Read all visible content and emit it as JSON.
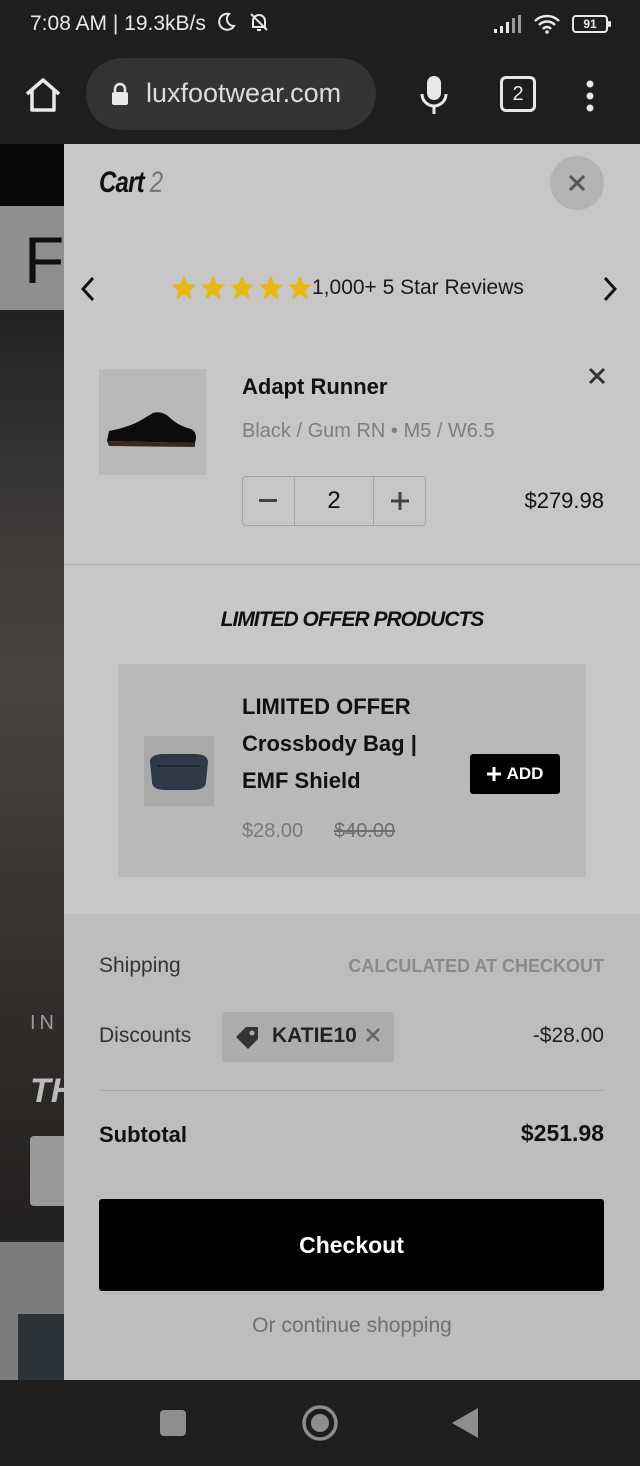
{
  "status_bar": {
    "time_and_speed": "7:08 AM | 19.3kB/s",
    "battery": "91"
  },
  "browser": {
    "url": "luxfootwear.com",
    "tab_count": "2"
  },
  "background_page": {
    "letter": "F",
    "text_in": "IN",
    "text_th": "TH"
  },
  "cart": {
    "title": "Cart",
    "count": "2",
    "reviews_text": "1,000+ 5 Star Reviews",
    "star_rating": 5,
    "line_item": {
      "name": "Adapt Runner",
      "variant": "Black / Gum RN • M5 / W6.5",
      "quantity": "2",
      "price": "$279.98"
    },
    "offer": {
      "heading": "LIMITED OFFER PRODUCTS",
      "title": "LIMITED OFFER Crossbody Bag | EMF Shield",
      "price": "$28.00",
      "compare_price": "$40.00",
      "add_label": "ADD"
    },
    "footer": {
      "shipping_label": "Shipping",
      "shipping_value": "CALCULATED AT CHECKOUT",
      "discounts_label": "Discounts",
      "discount_code": "KATIE10",
      "discount_amount": "-$28.00",
      "subtotal_label": "Subtotal",
      "subtotal_value": "$251.98",
      "checkout_label": "Checkout",
      "continue_label": "Or continue shopping"
    }
  },
  "colors": {
    "drawer_bg": "#c7c7c7",
    "star": "#e8b80e",
    "button_bg": "#000000"
  }
}
